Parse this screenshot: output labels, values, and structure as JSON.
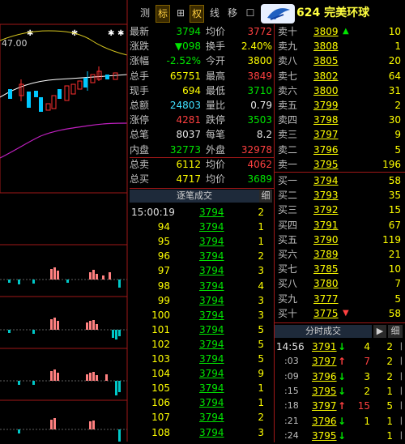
{
  "tabs": [
    {
      "label": "测"
    },
    {
      "label": "标",
      "active": true
    },
    {
      "label": "⊞"
    },
    {
      "label": "权"
    },
    {
      "label": "线"
    },
    {
      "label": "移"
    },
    {
      "label": "☐"
    }
  ],
  "stock_title": "624 完美环球",
  "chart": {
    "price_label": "47.00"
  },
  "quote": [
    {
      "label": "最新",
      "value": "3794",
      "cls": "green",
      "label2": "均价",
      "value2": "3772",
      "cls2": "red"
    },
    {
      "label": "涨跌",
      "value": "▼098",
      "cls": "green",
      "label2": "换手",
      "value2": "2.40%",
      "cls2": "yellow"
    },
    {
      "label": "涨幅",
      "value": "-2.52%",
      "cls": "green",
      "label2": "今开",
      "value2": "3800",
      "cls2": "yellow"
    },
    {
      "label": "总手",
      "value": "65751",
      "cls": "yellow",
      "label2": "最高",
      "value2": "3849",
      "cls2": "red"
    },
    {
      "label": "现手",
      "value": "694",
      "cls": "yellow",
      "label2": "最低",
      "value2": "3710",
      "cls2": "green"
    },
    {
      "label": "总额",
      "value": "24803",
      "cls": "cyan",
      "label2": "量比",
      "value2": "0.79",
      "cls2": "white"
    },
    {
      "label": "涨停",
      "value": "4281",
      "cls": "red",
      "label2": "跌停",
      "value2": "3503",
      "cls2": "green"
    },
    {
      "label": "总笔",
      "value": "8037",
      "cls": "white",
      "label2": "每笔",
      "value2": "8.2",
      "cls2": "white"
    },
    {
      "label": "内盘",
      "value": "32773",
      "cls": "green",
      "label2": "外盘",
      "value2": "32978",
      "cls2": "red"
    },
    {
      "label": "总卖",
      "value": "6112",
      "cls": "yellow",
      "label2": "均价",
      "value2": "4062",
      "cls2": "red"
    },
    {
      "label": "总买",
      "value": "4717",
      "cls": "yellow",
      "label2": "均价",
      "value2": "3689",
      "cls2": "green"
    }
  ],
  "asks": [
    {
      "label": "卖十",
      "price": "3809",
      "vol": "10",
      "mark": "▲"
    },
    {
      "label": "卖九",
      "price": "3808",
      "vol": "1"
    },
    {
      "label": "卖八",
      "price": "3805",
      "vol": "20"
    },
    {
      "label": "卖七",
      "price": "3802",
      "vol": "64"
    },
    {
      "label": "卖六",
      "price": "3800",
      "vol": "31"
    },
    {
      "label": "卖五",
      "price": "3799",
      "vol": "2"
    },
    {
      "label": "卖四",
      "price": "3798",
      "vol": "30"
    },
    {
      "label": "卖三",
      "price": "3797",
      "vol": "9"
    },
    {
      "label": "卖二",
      "price": "3796",
      "vol": "5"
    },
    {
      "label": "卖一",
      "price": "3795",
      "vol": "196"
    }
  ],
  "bids": [
    {
      "label": "买一",
      "price": "3794",
      "vol": "58"
    },
    {
      "label": "买二",
      "price": "3793",
      "vol": "35"
    },
    {
      "label": "买三",
      "price": "3792",
      "vol": "15"
    },
    {
      "label": "买四",
      "price": "3791",
      "vol": "67"
    },
    {
      "label": "买五",
      "price": "3790",
      "vol": "119"
    },
    {
      "label": "买六",
      "price": "3789",
      "vol": "21"
    },
    {
      "label": "买七",
      "price": "3785",
      "vol": "10"
    },
    {
      "label": "买八",
      "price": "3780",
      "vol": "7"
    },
    {
      "label": "买九",
      "price": "3777",
      "vol": "5"
    },
    {
      "label": "买十",
      "price": "3775",
      "vol": "58",
      "mark": "▼"
    }
  ],
  "tick_panel": {
    "title": "逐笔成交",
    "button": "细"
  },
  "ticks": [
    {
      "time": "15:00:19",
      "price": "3794",
      "vol": "2"
    },
    {
      "time": "94",
      "price": "3794",
      "vol": "1"
    },
    {
      "time": "95",
      "price": "3794",
      "vol": "1"
    },
    {
      "time": "96",
      "price": "3794",
      "vol": "2"
    },
    {
      "time": "97",
      "price": "3794",
      "vol": "3"
    },
    {
      "time": "98",
      "price": "3794",
      "vol": "4"
    },
    {
      "time": "99",
      "price": "3794",
      "vol": "3"
    },
    {
      "time": "100",
      "price": "3794",
      "vol": "3"
    },
    {
      "time": "101",
      "price": "3794",
      "vol": "5"
    },
    {
      "time": "102",
      "price": "3794",
      "vol": "5"
    },
    {
      "time": "103",
      "price": "3794",
      "vol": "5"
    },
    {
      "time": "104",
      "price": "3794",
      "vol": "9"
    },
    {
      "time": "105",
      "price": "3794",
      "vol": "1"
    },
    {
      "time": "106",
      "price": "3794",
      "vol": "1"
    },
    {
      "time": "107",
      "price": "3794",
      "vol": "2"
    },
    {
      "time": "108",
      "price": "3794",
      "vol": "3"
    }
  ],
  "min_panel": {
    "title": "分时成交",
    "play": "▶",
    "button": "细"
  },
  "min_ticks": [
    {
      "time": "14:56",
      "price": "3791",
      "arrow": "↓",
      "vol": "4",
      "num": "2",
      "cls": "green"
    },
    {
      "time": ":03",
      "price": "3797",
      "arrow": "↑",
      "vol": "7",
      "num": "2",
      "cls": "red"
    },
    {
      "time": ":09",
      "price": "3796",
      "arrow": "↓",
      "vol": "3",
      "num": "2",
      "cls": "green"
    },
    {
      "time": ":15",
      "price": "3795",
      "arrow": "↓",
      "vol": "2",
      "num": "1",
      "cls": "green"
    },
    {
      "time": ":18",
      "price": "3797",
      "arrow": "↑",
      "vol": "15",
      "num": "5",
      "cls": "red"
    },
    {
      "time": ":21",
      "price": "3796",
      "arrow": "↓",
      "vol": "1",
      "num": "1",
      "cls": "green"
    },
    {
      "time": ":24",
      "price": "3795",
      "arrow": "↓",
      "vol": "",
      "num": "1",
      "cls": "green"
    }
  ],
  "colors": {
    "red": "#ff4040",
    "green": "#00e600",
    "yellow": "#ffff00",
    "border": "#c02020"
  }
}
